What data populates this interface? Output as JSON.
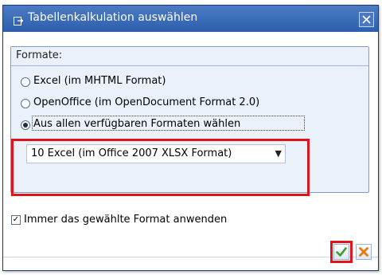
{
  "dialog": {
    "title": "Tabellenkalkulation auswählen",
    "title_icon": "spreadsheet-export-icon",
    "close_icon": "close-icon"
  },
  "formats": {
    "group_title": "Formate:",
    "options": [
      {
        "label": "Excel (im MHTML Format)",
        "selected": false
      },
      {
        "label": "OpenOffice (im OpenDocument Format 2.0)",
        "selected": false
      },
      {
        "label": "Aus allen verfügbaren Formaten wählen",
        "selected": true
      }
    ],
    "dropdown": {
      "selected_value": "10 Excel (im Office 2007 XLSX Format)",
      "arrow_icon": "dropdown-arrow-icon"
    }
  },
  "always_use": {
    "label": "Immer das gewählte Format anwenden",
    "checked": true
  },
  "buttons": {
    "ok_icon": "checkmark-icon",
    "cancel_icon": "cancel-x-icon"
  },
  "colors": {
    "title_bar": "#2c5fae",
    "highlight": "#e0141b",
    "ok_green": "#3a9e2b",
    "cancel_orange": "#e87a10"
  }
}
